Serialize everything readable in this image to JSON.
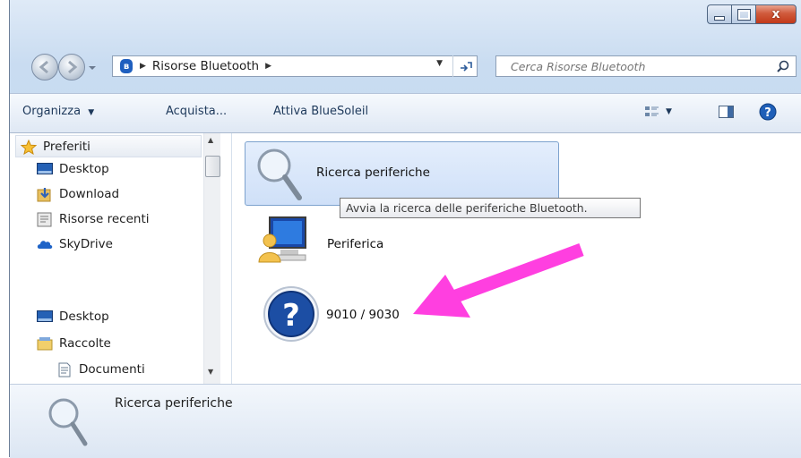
{
  "window": {
    "controls": {
      "minimize_icon": "minimize-icon",
      "maximize_icon": "maximize-icon",
      "close_label": "x"
    }
  },
  "address_bar": {
    "breadcrumb": [
      "Risorse Bluetooth"
    ],
    "search_placeholder": "Cerca Risorse Bluetooth"
  },
  "toolbar": {
    "organize_label": "Organizza",
    "buy_label": "Acquista...",
    "activate_label": "Attiva BlueSoleil"
  },
  "sidebar": {
    "items": [
      {
        "label": "Preferiti",
        "icon": "star-icon"
      },
      {
        "label": "Desktop",
        "icon": "desktop-icon"
      },
      {
        "label": "Download",
        "icon": "download-icon"
      },
      {
        "label": "Risorse recenti",
        "icon": "recent-places-icon"
      },
      {
        "label": "SkyDrive",
        "icon": "skydrive-icon"
      },
      {
        "label": "Desktop",
        "icon": "desktop-icon"
      },
      {
        "label": "Raccolte",
        "icon": "libraries-icon"
      },
      {
        "label": "Documenti",
        "icon": "documents-icon"
      }
    ]
  },
  "content": {
    "items": [
      {
        "label": "Ricerca periferiche",
        "icon": "magnifier-icon"
      },
      {
        "label": "Periferica",
        "icon": "user-computer-icon"
      },
      {
        "label": "9010 / 9030",
        "icon": "unknown-device-icon"
      }
    ],
    "tooltip": "Avvia la ricerca delle periferiche Bluetooth.",
    "annotation_color": "#ff3fe0"
  },
  "details_pane": {
    "title": "Ricerca periferiche",
    "icon": "magnifier-icon"
  }
}
